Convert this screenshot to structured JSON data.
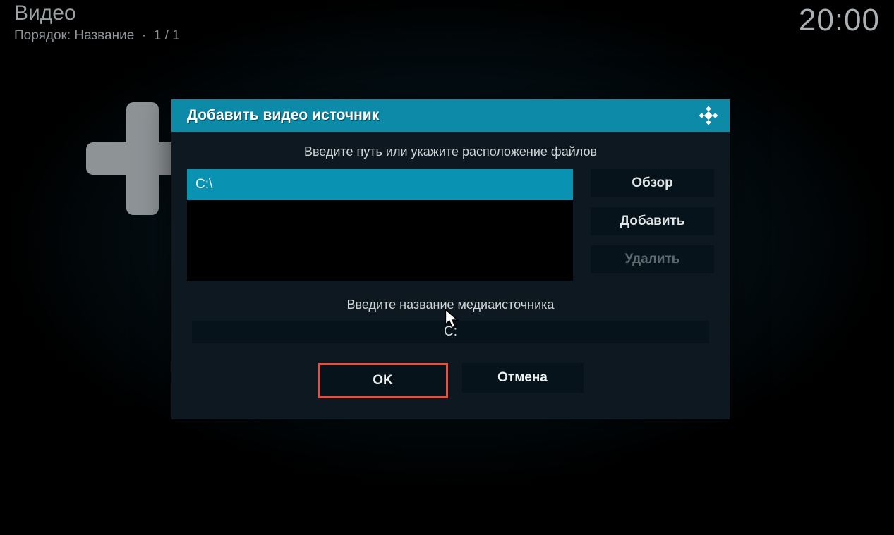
{
  "header": {
    "title": "Видео",
    "sort_prefix": "Порядок: ",
    "sort_value": "Название",
    "pager": "1 / 1",
    "clock": "20:00"
  },
  "dialog": {
    "title": "Добавить видео источник",
    "prompt_paths": "Введите путь или укажите расположение файлов",
    "path_value": "C:\\",
    "browse_btn": "Обзор",
    "add_btn": "Добавить",
    "remove_btn": "Удалить",
    "prompt_name": "Введите название медиаисточника",
    "name_value": "C:",
    "ok_btn": "OK",
    "cancel_btn": "Отмена"
  }
}
